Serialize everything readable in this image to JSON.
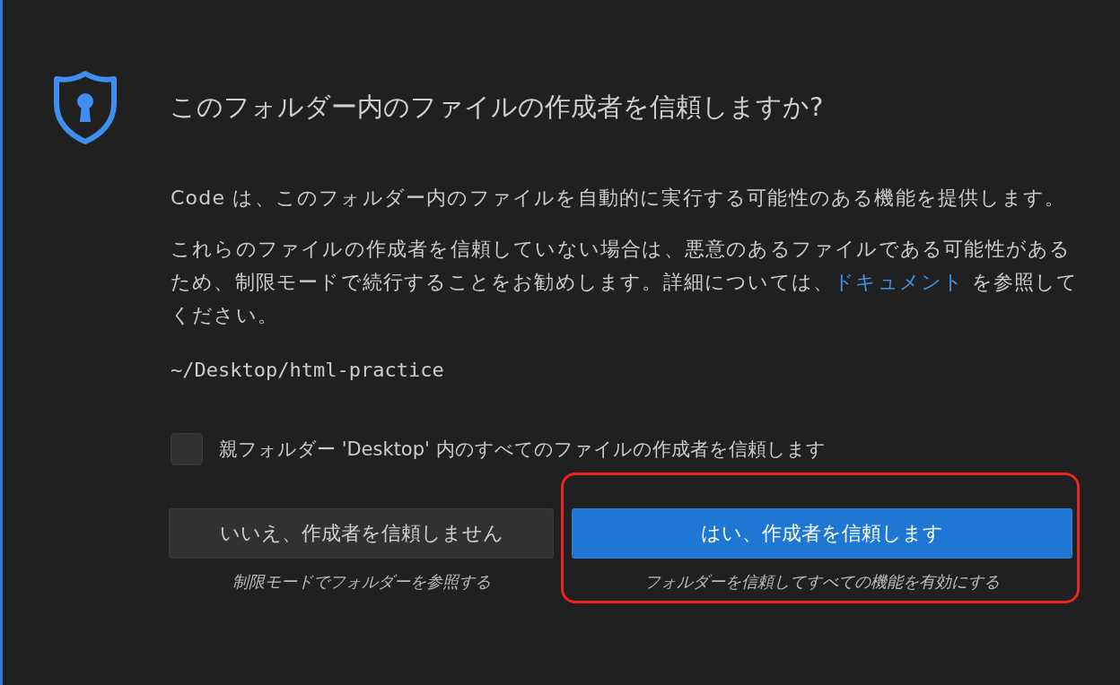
{
  "dialog": {
    "title": "このフォルダー内のファイルの作成者を信頼しますか?",
    "paragraphs": [
      {
        "before": "Code は、このフォルダー内のファイルを自動的に実行する可能性のある機能を提供します。"
      },
      {
        "before": "これらのファイルの作成者を信頼していない場合は、悪意のあるファイルである可能性があるため、制限モードで続行することをお勧めします。詳細については、",
        "link": "ドキュメント",
        "after": " を参照してください。"
      }
    ],
    "path": "~/Desktop/html-practice",
    "checkbox": {
      "label": "親フォルダー 'Desktop' 内のすべてのファイルの作成者を信頼します",
      "checked": false
    },
    "buttons": [
      {
        "kind": "secondary",
        "label": "いいえ、作成者を信頼しません",
        "caption": "制限モードでフォルダーを参照する",
        "highlighted": false
      },
      {
        "kind": "primary",
        "label": "はい、作成者を信頼します",
        "caption": "フォルダーを信頼してすべての機能を有効にする",
        "highlighted": true
      }
    ]
  }
}
